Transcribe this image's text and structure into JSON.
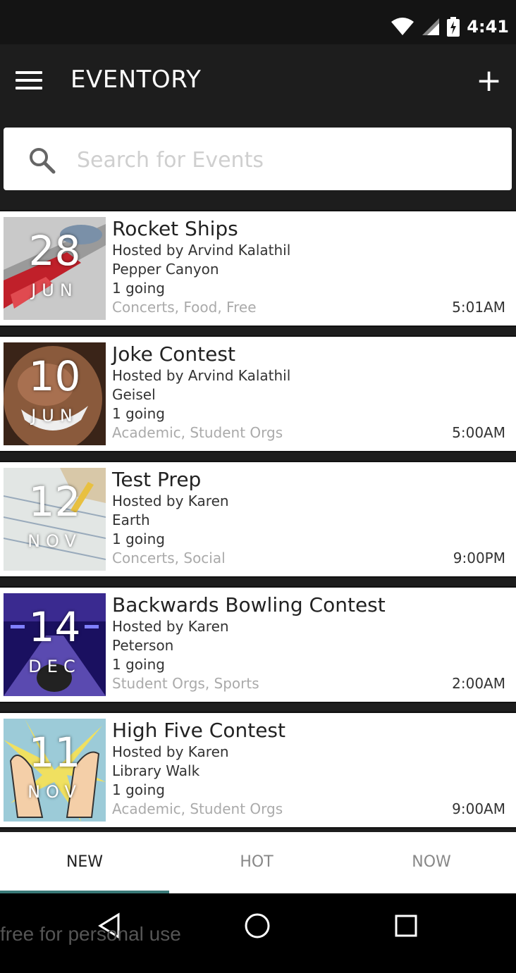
{
  "status_bar": {
    "time": "4:41"
  },
  "app_bar": {
    "title": "EVENTORY"
  },
  "search": {
    "placeholder": "Search for Events"
  },
  "events": [
    {
      "day": "28",
      "month": "JUN",
      "name": "Rocket Ships",
      "host": "Hosted by Arvind Kalathil",
      "location": "Pepper Canyon",
      "going": "1 going",
      "tags": "Concerts, Food, Free",
      "time": "5:01AM"
    },
    {
      "day": "10",
      "month": "JUN",
      "name": "Joke Contest",
      "host": "Hosted by Arvind Kalathil",
      "location": "Geisel",
      "going": "1 going",
      "tags": "Academic, Student Orgs",
      "time": "5:00AM"
    },
    {
      "day": "12",
      "month": "NOV",
      "name": "Test Prep",
      "host": "Hosted by Karen",
      "location": "Earth",
      "going": "1 going",
      "tags": "Concerts, Social",
      "time": "9:00PM"
    },
    {
      "day": "14",
      "month": "DEC",
      "name": "Backwards Bowling Contest",
      "host": "Hosted by Karen",
      "location": "Peterson",
      "going": "1 going",
      "tags": "Student Orgs, Sports",
      "time": "2:00AM"
    },
    {
      "day": "11",
      "month": "NOV",
      "name": "High Five Contest",
      "host": "Hosted by Karen",
      "location": "Library Walk",
      "going": "1 going",
      "tags": "Academic, Student Orgs",
      "time": "9:00AM"
    }
  ],
  "tabs": {
    "new": "NEW",
    "hot": "HOT",
    "now": "NOW",
    "selected": "NEW"
  },
  "watermark": "free for personal use"
}
